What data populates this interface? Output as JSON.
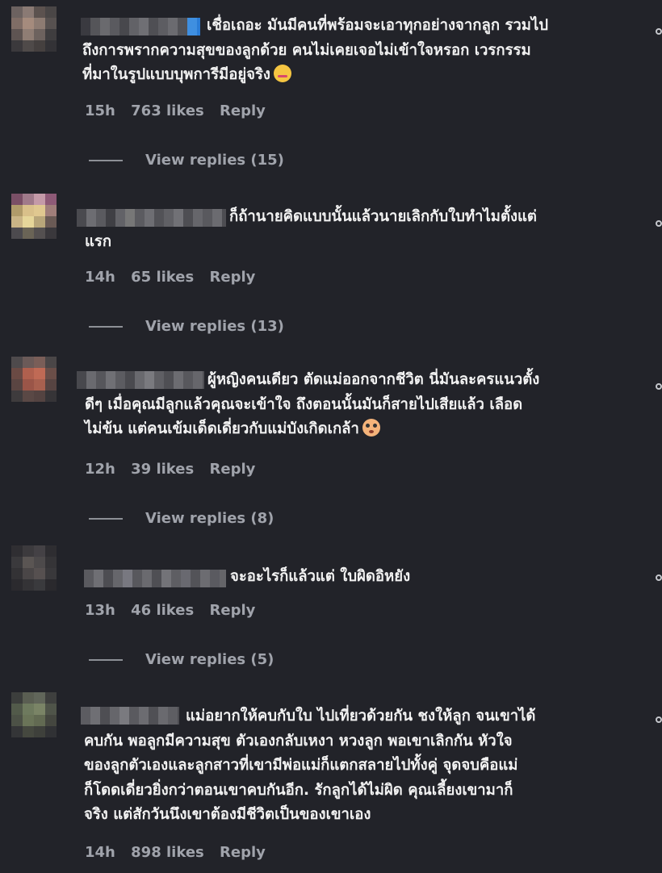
{
  "comments": [
    {
      "lines": [
        "เชื่อเถอะ มันมีคนที่พร้อมจะเอาทุกอย่างจากลูก รวมไป",
        "ถึงการพรากความสุขของลูกด้วย คนไม่เคยเจอไม่เข้าใจหรอก เวรกรรม",
        "ที่มาในรูปแบบบุพการีมีอยู่จริง"
      ],
      "emoji": "smirking-face-emoji",
      "time": "15h",
      "likes": "763 likes",
      "reply": "Reply",
      "view_replies": "View replies (15)"
    },
    {
      "lines": [
        "ก็ถ้านายคิดแบบนั้นแล้วนายเลิกกับใบทำไมตั้งแต่",
        "แรก"
      ],
      "time": "14h",
      "likes": "65 likes",
      "reply": "Reply",
      "view_replies": "View replies (13)"
    },
    {
      "lines": [
        "ผู้หญิงคนเดียว ตัดแม่ออกจากชีวิต นี่มันละครแนวตั้ง",
        "ดีๆ เมื่อคุณมีลูกแล้วคุณจะเข้าใจ ถึงตอนนั้นมันก็สายไปเสียแล้ว เลือด",
        "ไม่ข้น แต่คนเข้มเด็ดเดี่ยวกับแม่บังเกิดเกล้า"
      ],
      "emoji": "flushed-face-emoji",
      "time": "12h",
      "likes": "39 likes",
      "reply": "Reply",
      "view_replies": "View replies (8)"
    },
    {
      "lines": [
        "จะอะไรก็แล้วแต่ ใบผิดอิหยัง"
      ],
      "time": "13h",
      "likes": "46 likes",
      "reply": "Reply",
      "view_replies": "View replies (5)"
    },
    {
      "lines": [
        "แม่อยากให้คบกับใบ ไปเที่ยวด้วยกัน ชงให้ลูก จนเขาได้",
        "คบกัน พอลูกมีความสุข ตัวเองกลับเหงา หวงลูก พอเขาเลิกกัน หัวใจ",
        "ของลูกตัวเองและลูกสาวที่เขามีพ่อแม่ก็แตกสลายไปทั้งคู่ จุดจบคือแม่",
        "ก็โดดเดี่ยวยิ่งกว่าตอนเขาคบกันอีก. รักลูกได้ไม่ผิด คุณเลี้ยงเขามาก็",
        "จริง แต่สักวันนึงเขาต้องมีชีวิตเป็นของเขาเอง"
      ],
      "time": "14h",
      "likes": "898 likes",
      "reply": "Reply"
    }
  ]
}
